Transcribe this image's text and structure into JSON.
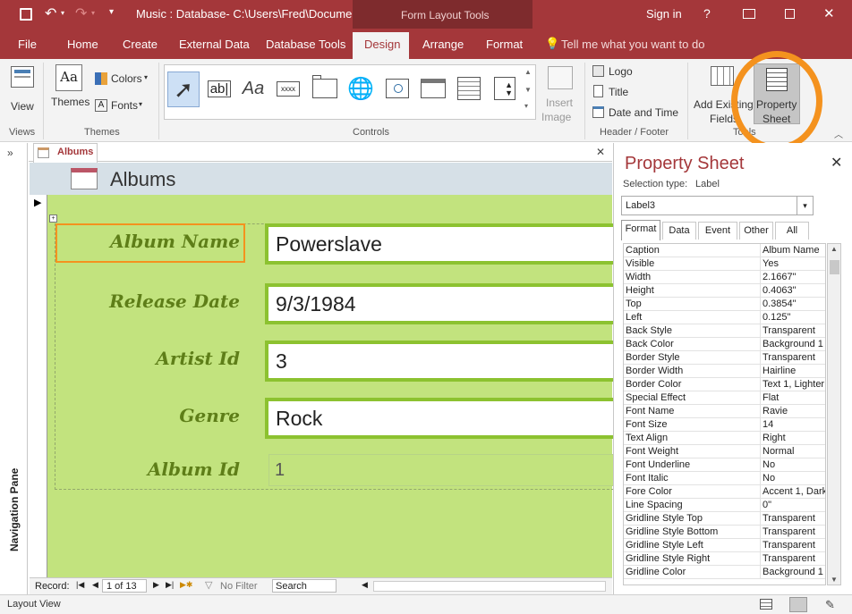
{
  "colors": {
    "accent": "#a4373a",
    "detail_bg": "#c2e37e",
    "field_border": "#8cc230",
    "label": "#5e7e18",
    "highlight": "#f4921e"
  },
  "titlebar": {
    "title": "Music : Database- C:\\Users\\Fred\\Docume...",
    "context": "Form Layout Tools",
    "signin": "Sign in",
    "help": "?"
  },
  "menu": {
    "file": "File",
    "home": "Home",
    "create": "Create",
    "external": "External Data",
    "dbtools": "Database Tools",
    "design": "Design",
    "arrange": "Arrange",
    "format": "Format",
    "tellme": "Tell me what you want to do"
  },
  "ribbon": {
    "view": "View",
    "views_group": "Views",
    "themes": "Themes",
    "colors": "Colors",
    "fonts": "Fonts",
    "themes_group": "Themes",
    "controls_group": "Controls",
    "textbox_glyph": "ab|",
    "label_glyph": "Aa",
    "button_glyph": "xxxx",
    "insert_image": "Insert",
    "insert_image2": "Image",
    "logo": "Logo",
    "title": "Title",
    "datetime": "Date and Time",
    "header_group": "Header / Footer",
    "add_fields": "Add Existing",
    "add_fields2": "Fields",
    "property": "Property",
    "property2": "Sheet",
    "tools_group": "Tools"
  },
  "nav": {
    "label": "Navigation Pane"
  },
  "doc": {
    "tab": "Albums",
    "header_title": "Albums"
  },
  "form": {
    "fields": [
      {
        "label": "Album Name",
        "value": "Powerslave"
      },
      {
        "label": "Release Date",
        "value": "9/3/1984"
      },
      {
        "label": "Artist Id",
        "value": "3"
      },
      {
        "label": "Genre",
        "value": "Rock"
      },
      {
        "label": "Album Id",
        "value": "1"
      }
    ]
  },
  "record": {
    "label": "Record:",
    "position": "1 of 13",
    "filter": "No Filter",
    "search": "Search"
  },
  "status": {
    "view": "Layout View"
  },
  "propsheet": {
    "title": "Property Sheet",
    "selection_label": "Selection type:",
    "selection_type": "Label",
    "object": "Label3",
    "tabs": [
      "Format",
      "Data",
      "Event",
      "Other",
      "All"
    ],
    "rows": [
      [
        "Caption",
        "Album Name"
      ],
      [
        "Visible",
        "Yes"
      ],
      [
        "Width",
        "2.1667\""
      ],
      [
        "Height",
        "0.4063\""
      ],
      [
        "Top",
        "0.3854\""
      ],
      [
        "Left",
        "0.125\""
      ],
      [
        "Back Style",
        "Transparent"
      ],
      [
        "Back Color",
        "Background 1"
      ],
      [
        "Border Style",
        "Transparent"
      ],
      [
        "Border Width",
        "Hairline"
      ],
      [
        "Border Color",
        "Text 1, Lighter"
      ],
      [
        "Special Effect",
        "Flat"
      ],
      [
        "Font Name",
        "Ravie"
      ],
      [
        "Font Size",
        "14"
      ],
      [
        "Text Align",
        "Right"
      ],
      [
        "Font Weight",
        "Normal"
      ],
      [
        "Font Underline",
        "No"
      ],
      [
        "Font Italic",
        "No"
      ],
      [
        "Fore Color",
        "Accent 1, Dark"
      ],
      [
        "Line Spacing",
        "0\""
      ],
      [
        "Gridline Style Top",
        "Transparent"
      ],
      [
        "Gridline Style Bottom",
        "Transparent"
      ],
      [
        "Gridline Style Left",
        "Transparent"
      ],
      [
        "Gridline Style Right",
        "Transparent"
      ],
      [
        "Gridline Color",
        "Background 1"
      ]
    ]
  }
}
